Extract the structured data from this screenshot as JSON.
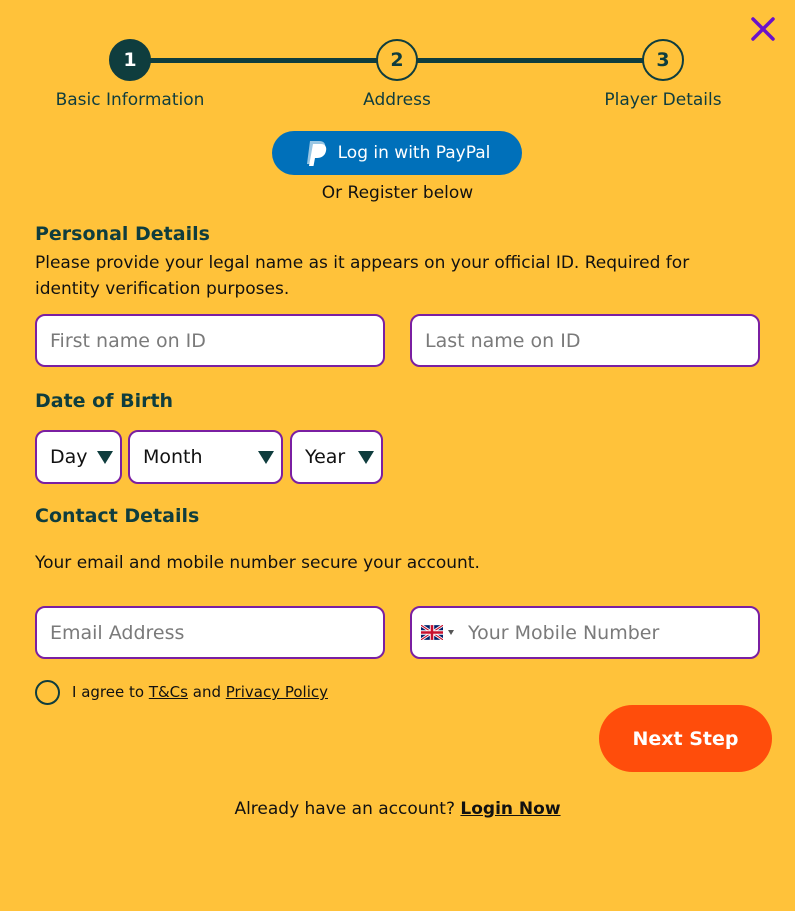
{
  "stepper": {
    "steps": [
      {
        "number": "1",
        "label": "Basic Information"
      },
      {
        "number": "2",
        "label": "Address"
      },
      {
        "number": "3",
        "label": "Player Details"
      }
    ],
    "active_step": 1
  },
  "paypal": {
    "label": "Log in with PayPal"
  },
  "or_register": "Or Register below",
  "personal": {
    "title": "Personal Details",
    "description": "Please provide your legal name as it appears on your official ID. Required for identity verification purposes.",
    "first_name_placeholder": "First name on ID",
    "last_name_placeholder": "Last name on ID"
  },
  "dob": {
    "title": "Date of Birth",
    "day": "Day",
    "month": "Month",
    "year": "Year"
  },
  "contact": {
    "title": "Contact Details",
    "description": "Your email and mobile number secure your account.",
    "email_placeholder": "Email Address",
    "mobile_placeholder": "Your Mobile Number",
    "country_icon": "uk-flag-icon"
  },
  "terms": {
    "prefix": "I agree to",
    "tcs": "T&Cs",
    "and": "and",
    "privacy": "Privacy Policy"
  },
  "next_button": "Next Step",
  "login": {
    "prompt": "Already have an account?",
    "link": "Login Now"
  },
  "colors": {
    "background": "#ffc23a",
    "primary_dark": "#0f3d3e",
    "border": "#7a1fa2",
    "close_icon": "#6a12c9",
    "next_button": "#ff4d0b",
    "paypal": "#0070ba"
  }
}
